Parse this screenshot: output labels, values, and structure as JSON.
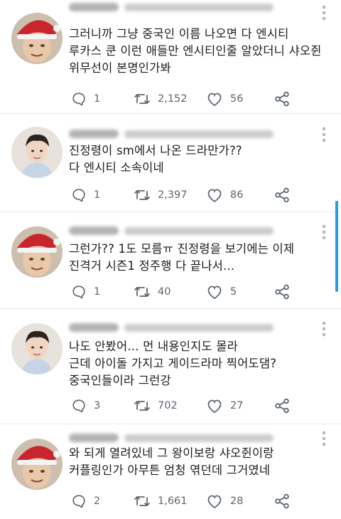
{
  "tweets": [
    {
      "text": "그러니까 그냥 중국인 이름 나오면 다 엔시티\n루카스 쿤 이런 애들만 엔시티인줄 알았더니 샤오쥔\n위무선이 본명인가봐",
      "replies": "1",
      "retweets": "2,152",
      "likes": "56"
    },
    {
      "text": "진정령이 sm에서 나온 드라만가??\n다 엔시티 소속이네",
      "replies": "1",
      "retweets": "2,397",
      "likes": "86"
    },
    {
      "text": "그런가?? 1도 모름ㅠ 진정령을 보기에는 이제\n진격거 시즌1 정주행 다 끝나서...",
      "replies": "1",
      "retweets": "40",
      "likes": "5"
    },
    {
      "text": "나도 안봤어... 먼 내용인지도 몰라\n근데 아이돌 가지고 게이드라마 찍어도댐?\n중국인들이라 그런강",
      "replies": "3",
      "retweets": "702",
      "likes": "27"
    },
    {
      "text": "와 되게 열려있네 그 왕이보랑 샤오쥔이랑\n커플링인가 아무튼 엄청 엮던데 그거였네",
      "replies": "2",
      "retweets": "1,661",
      "likes": "28"
    }
  ],
  "icons": {
    "reply": "reply-icon",
    "retweet": "retweet-icon",
    "like": "like-icon",
    "share": "share-icon",
    "more": "more-vertical-icon"
  },
  "colors": {
    "icon": "#5d6670",
    "accent_scrollbar": "#2d9cdb",
    "divider": "#e6ecf0"
  }
}
